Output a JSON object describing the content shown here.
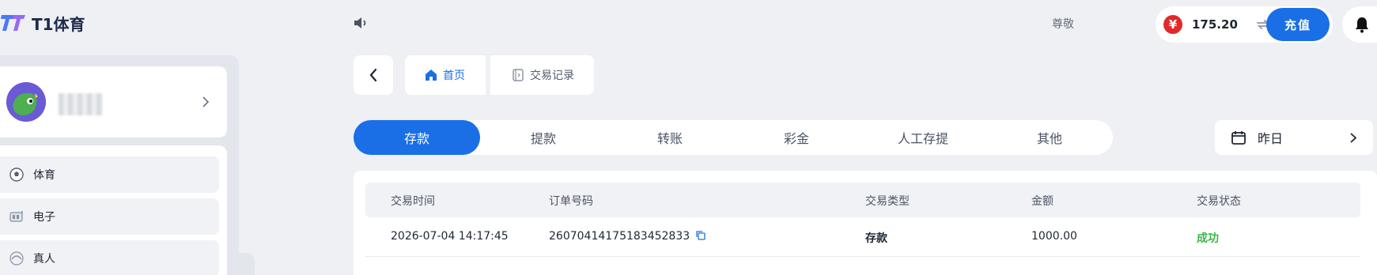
{
  "header": {
    "logo_text": "T1体育",
    "vip_label": "尊敬",
    "balance": "175.20",
    "currency_symbol": "¥",
    "recharge_label": "充值",
    "colors": {
      "accent": "#1a6fe6",
      "currency": "#e02a2a",
      "success": "#3bb54a"
    }
  },
  "sidebar": {
    "menu": [
      {
        "label": "体育",
        "icon": "soccer-ball-icon"
      },
      {
        "label": "电子",
        "icon": "slot-machine-icon"
      },
      {
        "label": "真人",
        "icon": "live-casino-icon"
      }
    ]
  },
  "breadcrumb": {
    "home_label": "首页",
    "records_label": "交易记录"
  },
  "tabs": [
    {
      "label": "存款",
      "active": true
    },
    {
      "label": "提款",
      "active": false
    },
    {
      "label": "转账",
      "active": false
    },
    {
      "label": "彩金",
      "active": false
    },
    {
      "label": "人工存提",
      "active": false
    },
    {
      "label": "其他",
      "active": false
    }
  ],
  "date_filter": {
    "value": "昨日",
    "icon": "calendar-icon"
  },
  "table": {
    "columns": [
      "交易时间",
      "订单号码",
      "交易类型",
      "金额",
      "交易状态"
    ],
    "rows": [
      {
        "time": "2026-07-04 14:17:45",
        "order_no": "26070414175183452833",
        "type": "存款",
        "amount": "1000.00",
        "status": "成功"
      }
    ]
  }
}
